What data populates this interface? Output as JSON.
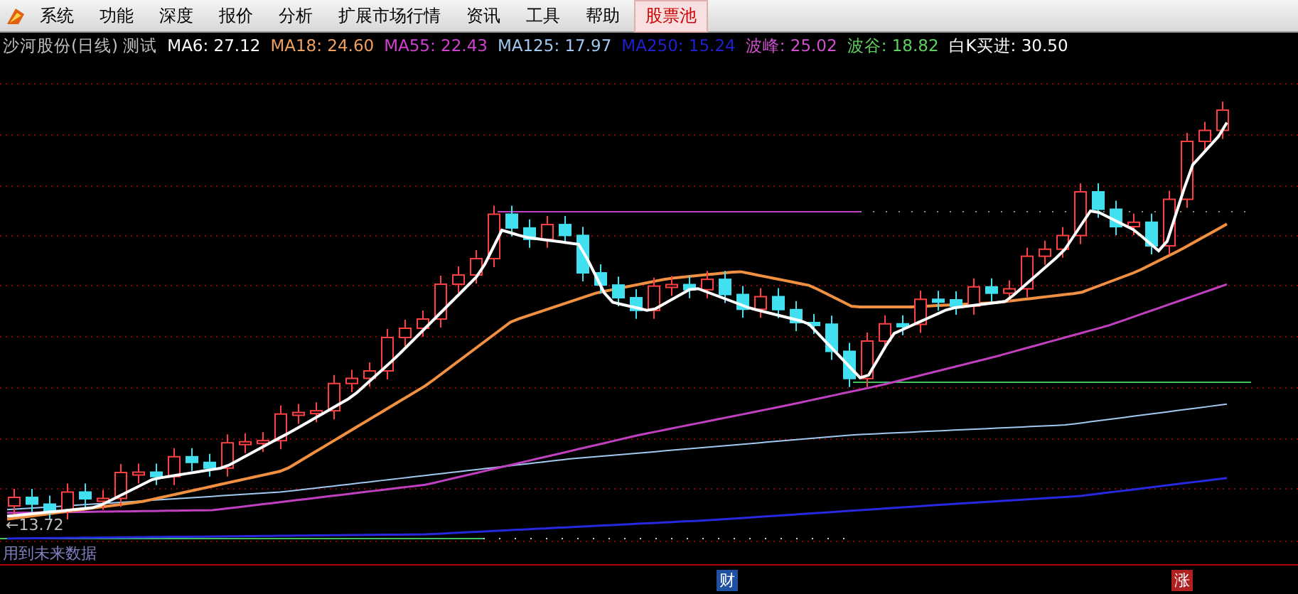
{
  "menu": [
    {
      "label": "系统",
      "selected": false
    },
    {
      "label": "功能",
      "selected": false
    },
    {
      "label": "深度",
      "selected": false
    },
    {
      "label": "报价",
      "selected": false
    },
    {
      "label": "分析",
      "selected": false
    },
    {
      "label": "扩展市场行情",
      "selected": false
    },
    {
      "label": "资讯",
      "selected": false
    },
    {
      "label": "工具",
      "selected": false
    },
    {
      "label": "帮助",
      "selected": false
    },
    {
      "label": "股票池",
      "selected": true
    }
  ],
  "legend": {
    "title": "沙河股份(日线) 测试",
    "items": [
      {
        "text": "MA6: 27.12",
        "color": "#ffffff"
      },
      {
        "text": "MA18: 24.60",
        "color": "#f0a060"
      },
      {
        "text": "MA55: 22.43",
        "color": "#d040d0"
      },
      {
        "text": "MA125: 17.97",
        "color": "#a0c8f0"
      },
      {
        "text": "MA250: 15.24",
        "color": "#2020d0"
      },
      {
        "text": "波峰: 25.02",
        "color": "#d050d0"
      },
      {
        "text": "波谷: 18.82",
        "color": "#60d060"
      },
      {
        "text": "白K买进: 30.50",
        "color": "#ffffff"
      }
    ]
  },
  "chart": {
    "low_label": "←13.72",
    "note": "用到未来数据"
  },
  "markers": [
    {
      "text": "财",
      "kind": "finance"
    },
    {
      "text": "涨",
      "kind": "rise"
    }
  ]
}
